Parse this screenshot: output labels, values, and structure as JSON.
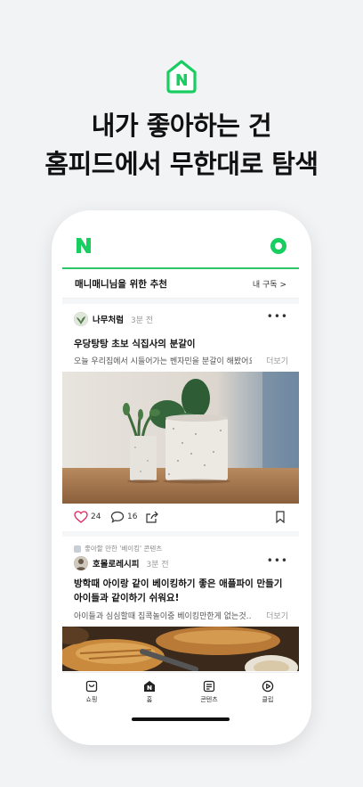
{
  "promo": {
    "headline_line1": "내가 좋아하는 건",
    "headline_line2": "홈피드에서 무한대로 탐색",
    "brand_color": "#19ce60"
  },
  "app": {
    "recommend_title": "매니매니님을 위한 추천",
    "subscribe_link": "내 구독 >"
  },
  "posts": [
    {
      "author": "나무처럼",
      "time": "3분 전",
      "title": "우당탕탕 초보 식집사의 분갈이",
      "desc": "오늘 우리집에서 시들어가는 벤자민을 분갈이 해봤어요",
      "more": "더보기",
      "likes": "24",
      "comments": "16",
      "image": "two-potted-plants"
    },
    {
      "tag": "좋아할 만한 '베이킹' 콘텐츠",
      "author": "호몰로레시피",
      "time": "3분 전",
      "title": "방학때 아이랑 같이 베이킹하기 좋은 애플파이 만들기 아이들과 같이하기 쉬워요!",
      "desc": "아이들과 심심할때 집콕놀이중 베이킹만한게 없는것…",
      "more": "더보기",
      "image": "baked-bread"
    }
  ],
  "tabs": [
    {
      "label": "쇼핑",
      "icon": "shopping-bag-icon"
    },
    {
      "label": "홈",
      "icon": "home-icon"
    },
    {
      "label": "콘텐츠",
      "icon": "content-icon"
    },
    {
      "label": "클립",
      "icon": "clip-icon"
    }
  ]
}
